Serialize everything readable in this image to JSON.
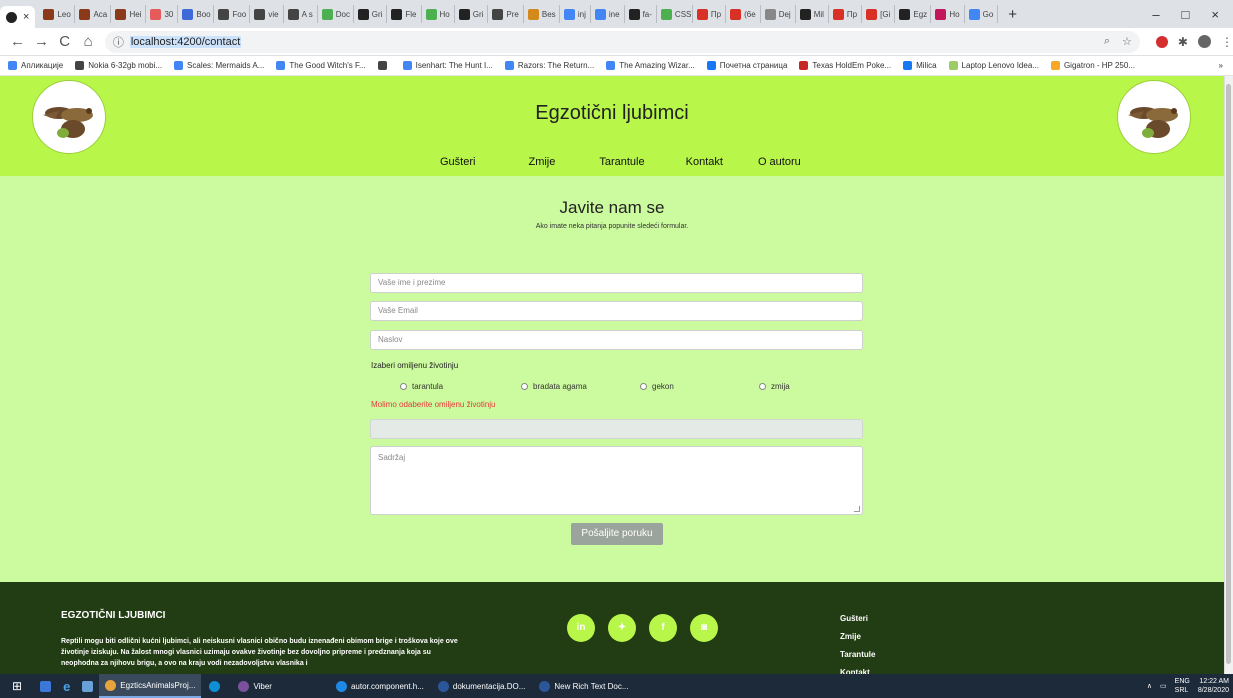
{
  "browser": {
    "tabs": [
      {
        "label": "Leo",
        "color": "#8a3a1a"
      },
      {
        "label": "Aca",
        "color": "#8a3a1a"
      },
      {
        "label": "Hei",
        "color": "#8a3a1a"
      },
      {
        "label": "30",
        "color": "#e55b5b"
      },
      {
        "label": "Boo",
        "color": "#3d6ad6"
      },
      {
        "label": "Foo",
        "color": "#444444"
      },
      {
        "label": "vie",
        "color": "#444444"
      },
      {
        "label": "A s",
        "color": "#444444"
      },
      {
        "label": "Doc",
        "color": "#4caf50"
      },
      {
        "label": "Gri",
        "color": "#222222"
      },
      {
        "label": "Fle",
        "color": "#222222"
      },
      {
        "label": "Ho",
        "color": "#4caf50"
      },
      {
        "label": "Gri",
        "color": "#222222"
      },
      {
        "label": "Pre",
        "color": "#444444"
      },
      {
        "label": "Bes",
        "color": "#d48a1a"
      },
      {
        "label": "inj",
        "color": "#4285f4"
      },
      {
        "label": "ine",
        "color": "#4285f4"
      },
      {
        "label": "fa-",
        "color": "#222222"
      },
      {
        "label": "CSS",
        "color": "#4caf50"
      },
      {
        "label": "Пр",
        "color": "#d93025"
      },
      {
        "label": "(6e",
        "color": "#d93025"
      },
      {
        "label": "Dej",
        "color": "#888888"
      },
      {
        "label": "Mil",
        "color": "#222222"
      },
      {
        "label": "Пр",
        "color": "#d93025"
      },
      {
        "label": "[Gi",
        "color": "#d93025"
      },
      {
        "label": "Egz",
        "color": "#222222"
      },
      {
        "label": "Ho",
        "color": "#c2185b"
      },
      {
        "label": "Go",
        "color": "#4285f4"
      }
    ],
    "new_tab": "+",
    "back": "←",
    "forward": "→",
    "reload": "C",
    "home": "⌂",
    "info": "ⓘ",
    "url": "localhost:4200/contact",
    "window_min": "–",
    "window_max": "□",
    "window_close": "×",
    "bookmarks": [
      {
        "label": "Апликације",
        "color": "#4285f4"
      },
      {
        "label": "Nokia 6-32gb mobi...",
        "color": "#444444"
      },
      {
        "label": "Scales: Mermaids A...",
        "color": "#4285f4"
      },
      {
        "label": "The Good Witch's F...",
        "color": "#4285f4"
      },
      {
        "label": "",
        "color": "#444444"
      },
      {
        "label": "Isenhart: The Hunt I...",
        "color": "#4285f4"
      },
      {
        "label": "Razors: The Return...",
        "color": "#4285f4"
      },
      {
        "label": "The Amazing Wizar...",
        "color": "#4285f4"
      },
      {
        "label": "Почетна страница",
        "color": "#1877f2"
      },
      {
        "label": "Texas HoldEm Poke...",
        "color": "#c62828"
      },
      {
        "label": "Milica",
        "color": "#1877f2"
      },
      {
        "label": "Laptop Lenovo Idea...",
        "color": "#9ccc65"
      },
      {
        "label": "Gigatron - HP 250...",
        "color": "#f9a825"
      }
    ],
    "bookmarks_more": "»"
  },
  "site": {
    "title": "Egzotični ljubimci",
    "nav": [
      "Gušteri",
      "Zmije",
      "Tarantule",
      "Kontakt",
      "O autoru"
    ]
  },
  "contact": {
    "title": "Javite nam se",
    "subtitle": "Ako imate neka pitanja popunite sledeći formular.",
    "name_placeholder": "Vaše ime i prezime",
    "email_placeholder": "Vaše Email",
    "subject_placeholder": "Naslov",
    "pet_label": "Izaberi omiljenu životinju",
    "pets": [
      "tarantula",
      "bradata agama",
      "gekon",
      "zmija"
    ],
    "error": "Molimo odaberite omiljenu životinju",
    "message_placeholder": "Sadržaj",
    "send": "Pošaljite poruku"
  },
  "footer": {
    "title": "EGZOTIČNI LJUBIMCI",
    "text": "Reptili mogu biti odlični kućni ljubimci, ali neiskusni vlasnici obično budu iznenađeni obimom brige i troškova koje ove životinje iziskuju. Na žalost mnogi vlasnici uzimaju ovakve životinje bez dovoljno pripreme i predznanja koja su neophodna za njihovu brigu, a ovo na kraju vodi nezadovoljstvu vlasnika i",
    "social": [
      {
        "name": "linkedin-icon",
        "glyph": "in"
      },
      {
        "name": "twitter-icon",
        "glyph": "✦"
      },
      {
        "name": "facebook-icon",
        "glyph": "f"
      },
      {
        "name": "instagram-icon",
        "glyph": "◙"
      }
    ],
    "links": [
      "Gušteri",
      "Zmije",
      "Tarantule",
      "Kontakt"
    ]
  },
  "taskbar": {
    "items": [
      {
        "label": "EgzticsAnimalsProj...",
        "color": "#e8a33d",
        "active": true
      },
      {
        "label": "",
        "color": "#0f8fd6",
        "active": false
      },
      {
        "label": "Viber",
        "color": "#7b519d",
        "active": false
      },
      {
        "label": "autor.component.h...",
        "color": "#1e88e5",
        "active": false
      },
      {
        "label": "dokumentacija.DO...",
        "color": "#2b579a",
        "active": false
      },
      {
        "label": "New Rich Text Doc...",
        "color": "#2b579a",
        "active": false
      }
    ],
    "lang": "ENG",
    "region": "SRL",
    "time": "12:22 AM",
    "date": "8/28/2020"
  }
}
